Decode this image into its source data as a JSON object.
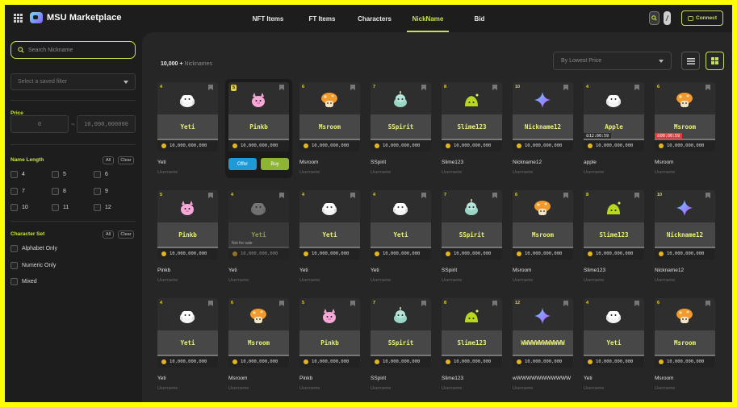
{
  "header": {
    "app_name": "MSU Marketplace",
    "nav": [
      {
        "label": "NFT Items",
        "active": false
      },
      {
        "label": "FT Items",
        "active": false
      },
      {
        "label": "Characters",
        "active": false
      },
      {
        "label": "NickName",
        "active": true
      },
      {
        "label": "Bid",
        "active": false
      }
    ],
    "connect_label": "Connect"
  },
  "colors": {
    "accent": "#c6e34a",
    "offer": "#1e9ad6",
    "buy": "#8db533",
    "timer_alert": "#e53a3a"
  },
  "sidebar": {
    "search_placeholder": "Search Nickname",
    "saved_filter_placeholder": "Select a saved filter",
    "price_label": "Price",
    "price_min": "0",
    "price_max": "10,000,000000",
    "price_separator": "~",
    "name_length_label": "Name Length",
    "all_label": "All",
    "clear_label": "Clear",
    "name_lengths": [
      "4",
      "5",
      "6",
      "7",
      "8",
      "9",
      "10",
      "11",
      "12"
    ],
    "character_set_label": "Character Set",
    "character_sets": [
      "Alphabet Only",
      "Numeric Only",
      "Mixed"
    ]
  },
  "main": {
    "count_value": "10,000 +",
    "count_label": "Nicknames",
    "sort_value": "By Lowest Price",
    "offer_label": "Offer",
    "buy_label": "Buy",
    "not_for_sale_label": "Not for sale"
  },
  "cards": [
    {
      "badge": "4",
      "nick": "Yeti",
      "price": "10,000,000,000",
      "title": "Yeti",
      "owner": "Username",
      "sprite": "yeti"
    },
    {
      "badge": "5",
      "nick": "Pinkb",
      "price": "10,000,000,000",
      "title": "",
      "owner": "",
      "sprite": "pinkbean",
      "hover": true
    },
    {
      "badge": "6",
      "nick": "Msroom",
      "price": "10,000,000,000",
      "title": "Msroom",
      "owner": "Username",
      "sprite": "mushroom"
    },
    {
      "badge": "7",
      "nick": "SSpirit",
      "price": "10,000,000,000",
      "title": "SSpirit",
      "owner": "Username",
      "sprite": "spirit"
    },
    {
      "badge": "8",
      "nick": "Slime123",
      "price": "10,000,000,000",
      "title": "Slime123",
      "owner": "Username",
      "sprite": "slime"
    },
    {
      "badge": "10",
      "nick": "Nickname12",
      "price": "10,000,000,000",
      "title": "Nickname12",
      "owner": "Username",
      "sprite": "star"
    },
    {
      "badge": "4",
      "nick": "Apple",
      "price": "10,000,000,000",
      "title": "apple",
      "owner": "Username",
      "sprite": "yeti",
      "timer": "12:00:59"
    },
    {
      "badge": "6",
      "nick": "Msroom",
      "price": "10,000,000,000",
      "title": "Msroom",
      "owner": "Username",
      "sprite": "mushroom",
      "timer": "00:00:59",
      "timer_red": true
    },
    {
      "badge": "5",
      "nick": "Pinkb",
      "price": "10,000,000,000",
      "title": "Pinkb",
      "owner": "Username",
      "sprite": "pinkbean"
    },
    {
      "badge": "4",
      "nick": "Yeti",
      "price": "10,000,000,000",
      "title": "Yeti",
      "owner": "Username",
      "sprite": "yeti",
      "not_for_sale": true
    },
    {
      "badge": "4",
      "nick": "Yeti",
      "price": "10,000,000,000",
      "title": "Yeti",
      "owner": "Username",
      "sprite": "yeti"
    },
    {
      "badge": "4",
      "nick": "Yeti",
      "price": "10,000,000,000",
      "title": "Yeti",
      "owner": "Username",
      "sprite": "yeti"
    },
    {
      "badge": "7",
      "nick": "SSpirit",
      "price": "10,000,000,000",
      "title": "SSpirit",
      "owner": "Username",
      "sprite": "spirit"
    },
    {
      "badge": "6",
      "nick": "Msroom",
      "price": "10,000,000,000",
      "title": "Msroom",
      "owner": "Username",
      "sprite": "mushroom"
    },
    {
      "badge": "8",
      "nick": "Slime123",
      "price": "10,000,000,000",
      "title": "Slime123",
      "owner": "Username",
      "sprite": "slime"
    },
    {
      "badge": "10",
      "nick": "Nickname12",
      "price": "10,000,000,000",
      "title": "Nickname12",
      "owner": "Username",
      "sprite": "star"
    },
    {
      "badge": "4",
      "nick": "Yeti",
      "price": "10,000,000,000",
      "title": "Yeti",
      "owner": "Username",
      "sprite": "yeti"
    },
    {
      "badge": "6",
      "nick": "Msroom",
      "price": "10,000,000,000",
      "title": "Msroom",
      "owner": "Username",
      "sprite": "mushroom"
    },
    {
      "badge": "5",
      "nick": "Pinkb",
      "price": "10,000,000,000",
      "title": "Pinkb",
      "owner": "Username",
      "sprite": "pinkbean"
    },
    {
      "badge": "7",
      "nick": "SSpirit",
      "price": "10,000,000,000",
      "title": "SSpirit",
      "owner": "Username",
      "sprite": "spirit"
    },
    {
      "badge": "8",
      "nick": "Slime123",
      "price": "10,000,000,000",
      "title": "Slime123",
      "owner": "Username",
      "sprite": "slime"
    },
    {
      "badge": "12",
      "nick": "WWWWWWWWWWWW",
      "price": "10,000,000,000",
      "title": "wWWWWWWWWWWW",
      "owner": "Username",
      "sprite": "star"
    },
    {
      "badge": "4",
      "nick": "Yeti",
      "price": "10,000,000,000",
      "title": "Yeti",
      "owner": "Username",
      "sprite": "yeti"
    },
    {
      "badge": "6",
      "nick": "Msroom",
      "price": "10,000,000,000",
      "title": "Msroom",
      "owner": "Username",
      "sprite": "mushroom"
    }
  ]
}
